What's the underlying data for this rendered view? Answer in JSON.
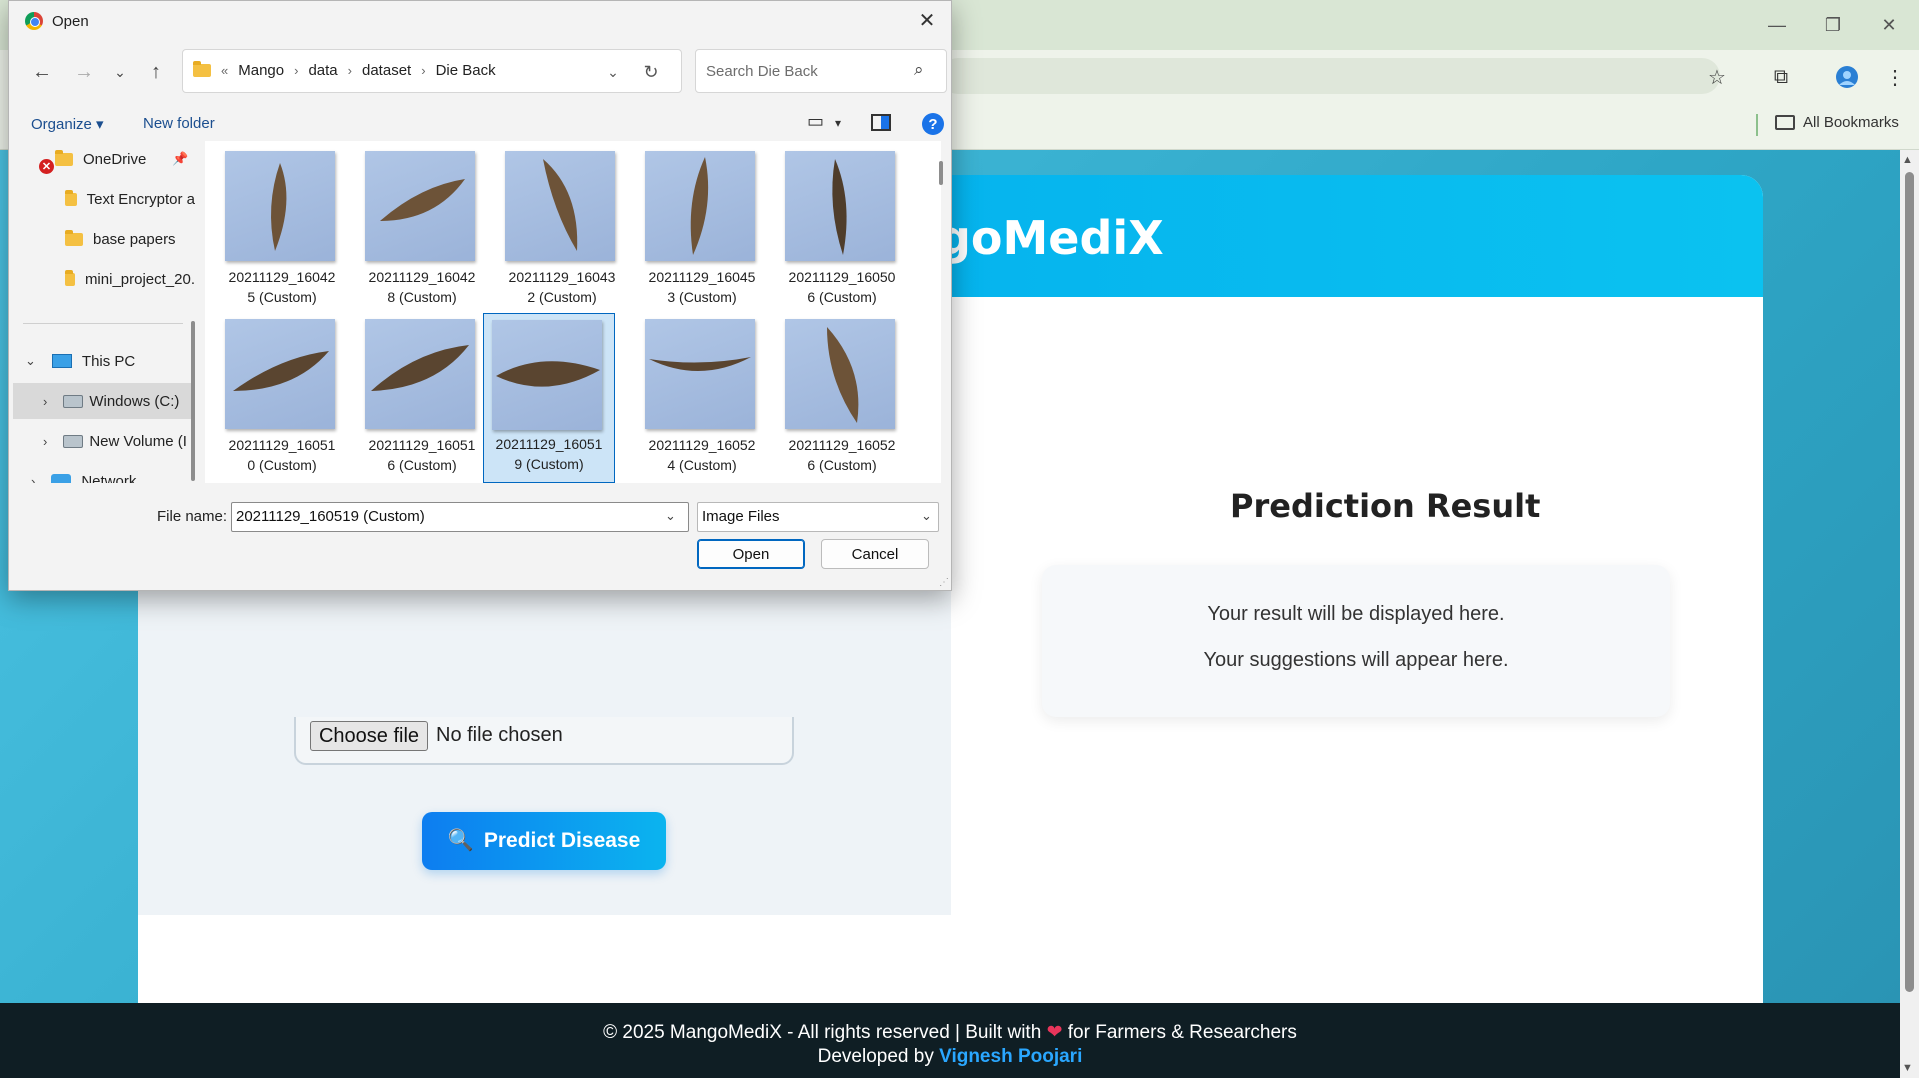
{
  "browser": {
    "window_controls": [
      "—",
      "❐",
      "✕"
    ],
    "bookmarks_label": "All Bookmarks"
  },
  "site": {
    "brand": "goMediX",
    "choose_file": "Choose file",
    "no_file": "No file chosen",
    "predict_button": "Predict Disease",
    "predict_icon": "🔍",
    "result_title": "Prediction Result",
    "result_line1": "Your result will be displayed here.",
    "result_line2": "Your suggestions will appear here.",
    "footer_line1_a": "© 2025 MangoMediX - All rights reserved | Built with",
    "footer_heart": "❤",
    "footer_line1_b": "for Farmers & Researchers",
    "footer_dev_prefix": "Developed by",
    "footer_dev_name": "Vignesh Poojari",
    "colors": {
      "header": "#00a6ec",
      "button": "#0d7df0",
      "footer": "#0f1e24",
      "dev_name": "#2aa7ff"
    }
  },
  "dialog": {
    "title": "Open",
    "path": [
      "«",
      "Mango",
      "data",
      "dataset",
      "Die Back"
    ],
    "search_placeholder": "Search Die Back",
    "organize": "Organize ▾",
    "new_folder": "New folder",
    "nav": [
      {
        "label": "OneDrive",
        "icon": "cloud-icon"
      },
      {
        "label": "Text Encryptor a",
        "icon": "folder-icon"
      },
      {
        "label": "base papers",
        "icon": "folder-icon"
      },
      {
        "label": "mini_project_20.",
        "icon": "folder-icon"
      },
      {
        "label": "This PC",
        "icon": "pc-icon"
      },
      {
        "label": "Windows (C:)",
        "icon": "drive-icon"
      },
      {
        "label": "New Volume (I",
        "icon": "drive-icon"
      },
      {
        "label": "Network",
        "icon": "network-icon"
      }
    ],
    "files": [
      {
        "line1": "20211129_16042",
        "line2": "5 (Custom)"
      },
      {
        "line1": "20211129_16042",
        "line2": "8 (Custom)"
      },
      {
        "line1": "20211129_16043",
        "line2": "2 (Custom)"
      },
      {
        "line1": "20211129_16045",
        "line2": "3 (Custom)"
      },
      {
        "line1": "20211129_16050",
        "line2": "6 (Custom)"
      },
      {
        "line1": "20211129_16051",
        "line2": "0 (Custom)"
      },
      {
        "line1": "20211129_16051",
        "line2": "6 (Custom)"
      },
      {
        "line1": "20211129_16051",
        "line2": "9 (Custom)"
      },
      {
        "line1": "20211129_16052",
        "line2": "4 (Custom)"
      },
      {
        "line1": "20211129_16052",
        "line2": "6 (Custom)"
      }
    ],
    "selected_file_index": 7,
    "file_name_label": "File name:",
    "file_name_value": "20211129_160519 (Custom)",
    "file_type": "Image Files",
    "open_button": "Open",
    "cancel_button": "Cancel"
  }
}
